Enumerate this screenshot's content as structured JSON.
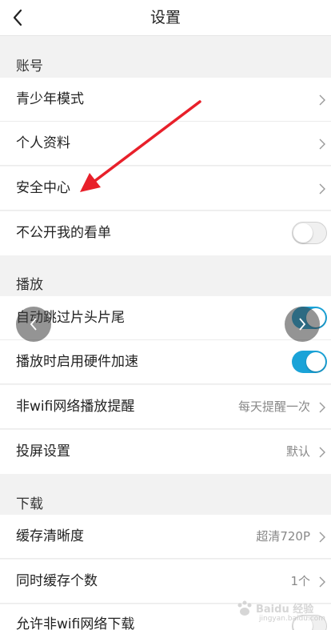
{
  "header": {
    "title": "设置",
    "back_icon": "chevron-left-icon"
  },
  "sections": {
    "account": {
      "title": "账号",
      "rows": {
        "teen_mode": {
          "label": "青少年模式"
        },
        "profile": {
          "label": "个人资料"
        },
        "security": {
          "label": "安全中心"
        },
        "private_watchlist": {
          "label": "不公开我的看单",
          "toggle": "off"
        }
      }
    },
    "playback": {
      "title": "播放",
      "rows": {
        "skip_intro": {
          "label": "自动跳过片头片尾",
          "toggle": "on"
        },
        "hw_accel": {
          "label": "播放时启用硬件加速",
          "toggle": "on"
        },
        "non_wifi_reminder": {
          "label": "非wifi网络播放提醒",
          "value": "每天提醒一次"
        },
        "cast": {
          "label": "投屏设置",
          "value": "默认"
        }
      }
    },
    "download": {
      "title": "下载",
      "rows": {
        "cache_quality": {
          "label": "缓存清晰度",
          "value": "超清720P"
        },
        "concurrent": {
          "label": "同时缓存个数",
          "value": "1个"
        },
        "non_wifi_download": {
          "label": "允许非wifi网络下载",
          "toggle": "off"
        }
      }
    }
  },
  "overlay": {
    "prev_icon": "chevron-left-icon",
    "next_icon": "chevron-right-icon"
  },
  "watermark": {
    "text": "Baidu 经验",
    "url": "jingyan.baidu.com"
  },
  "colors": {
    "accent": "#1aa3d8",
    "arrow": "#e8202a"
  }
}
